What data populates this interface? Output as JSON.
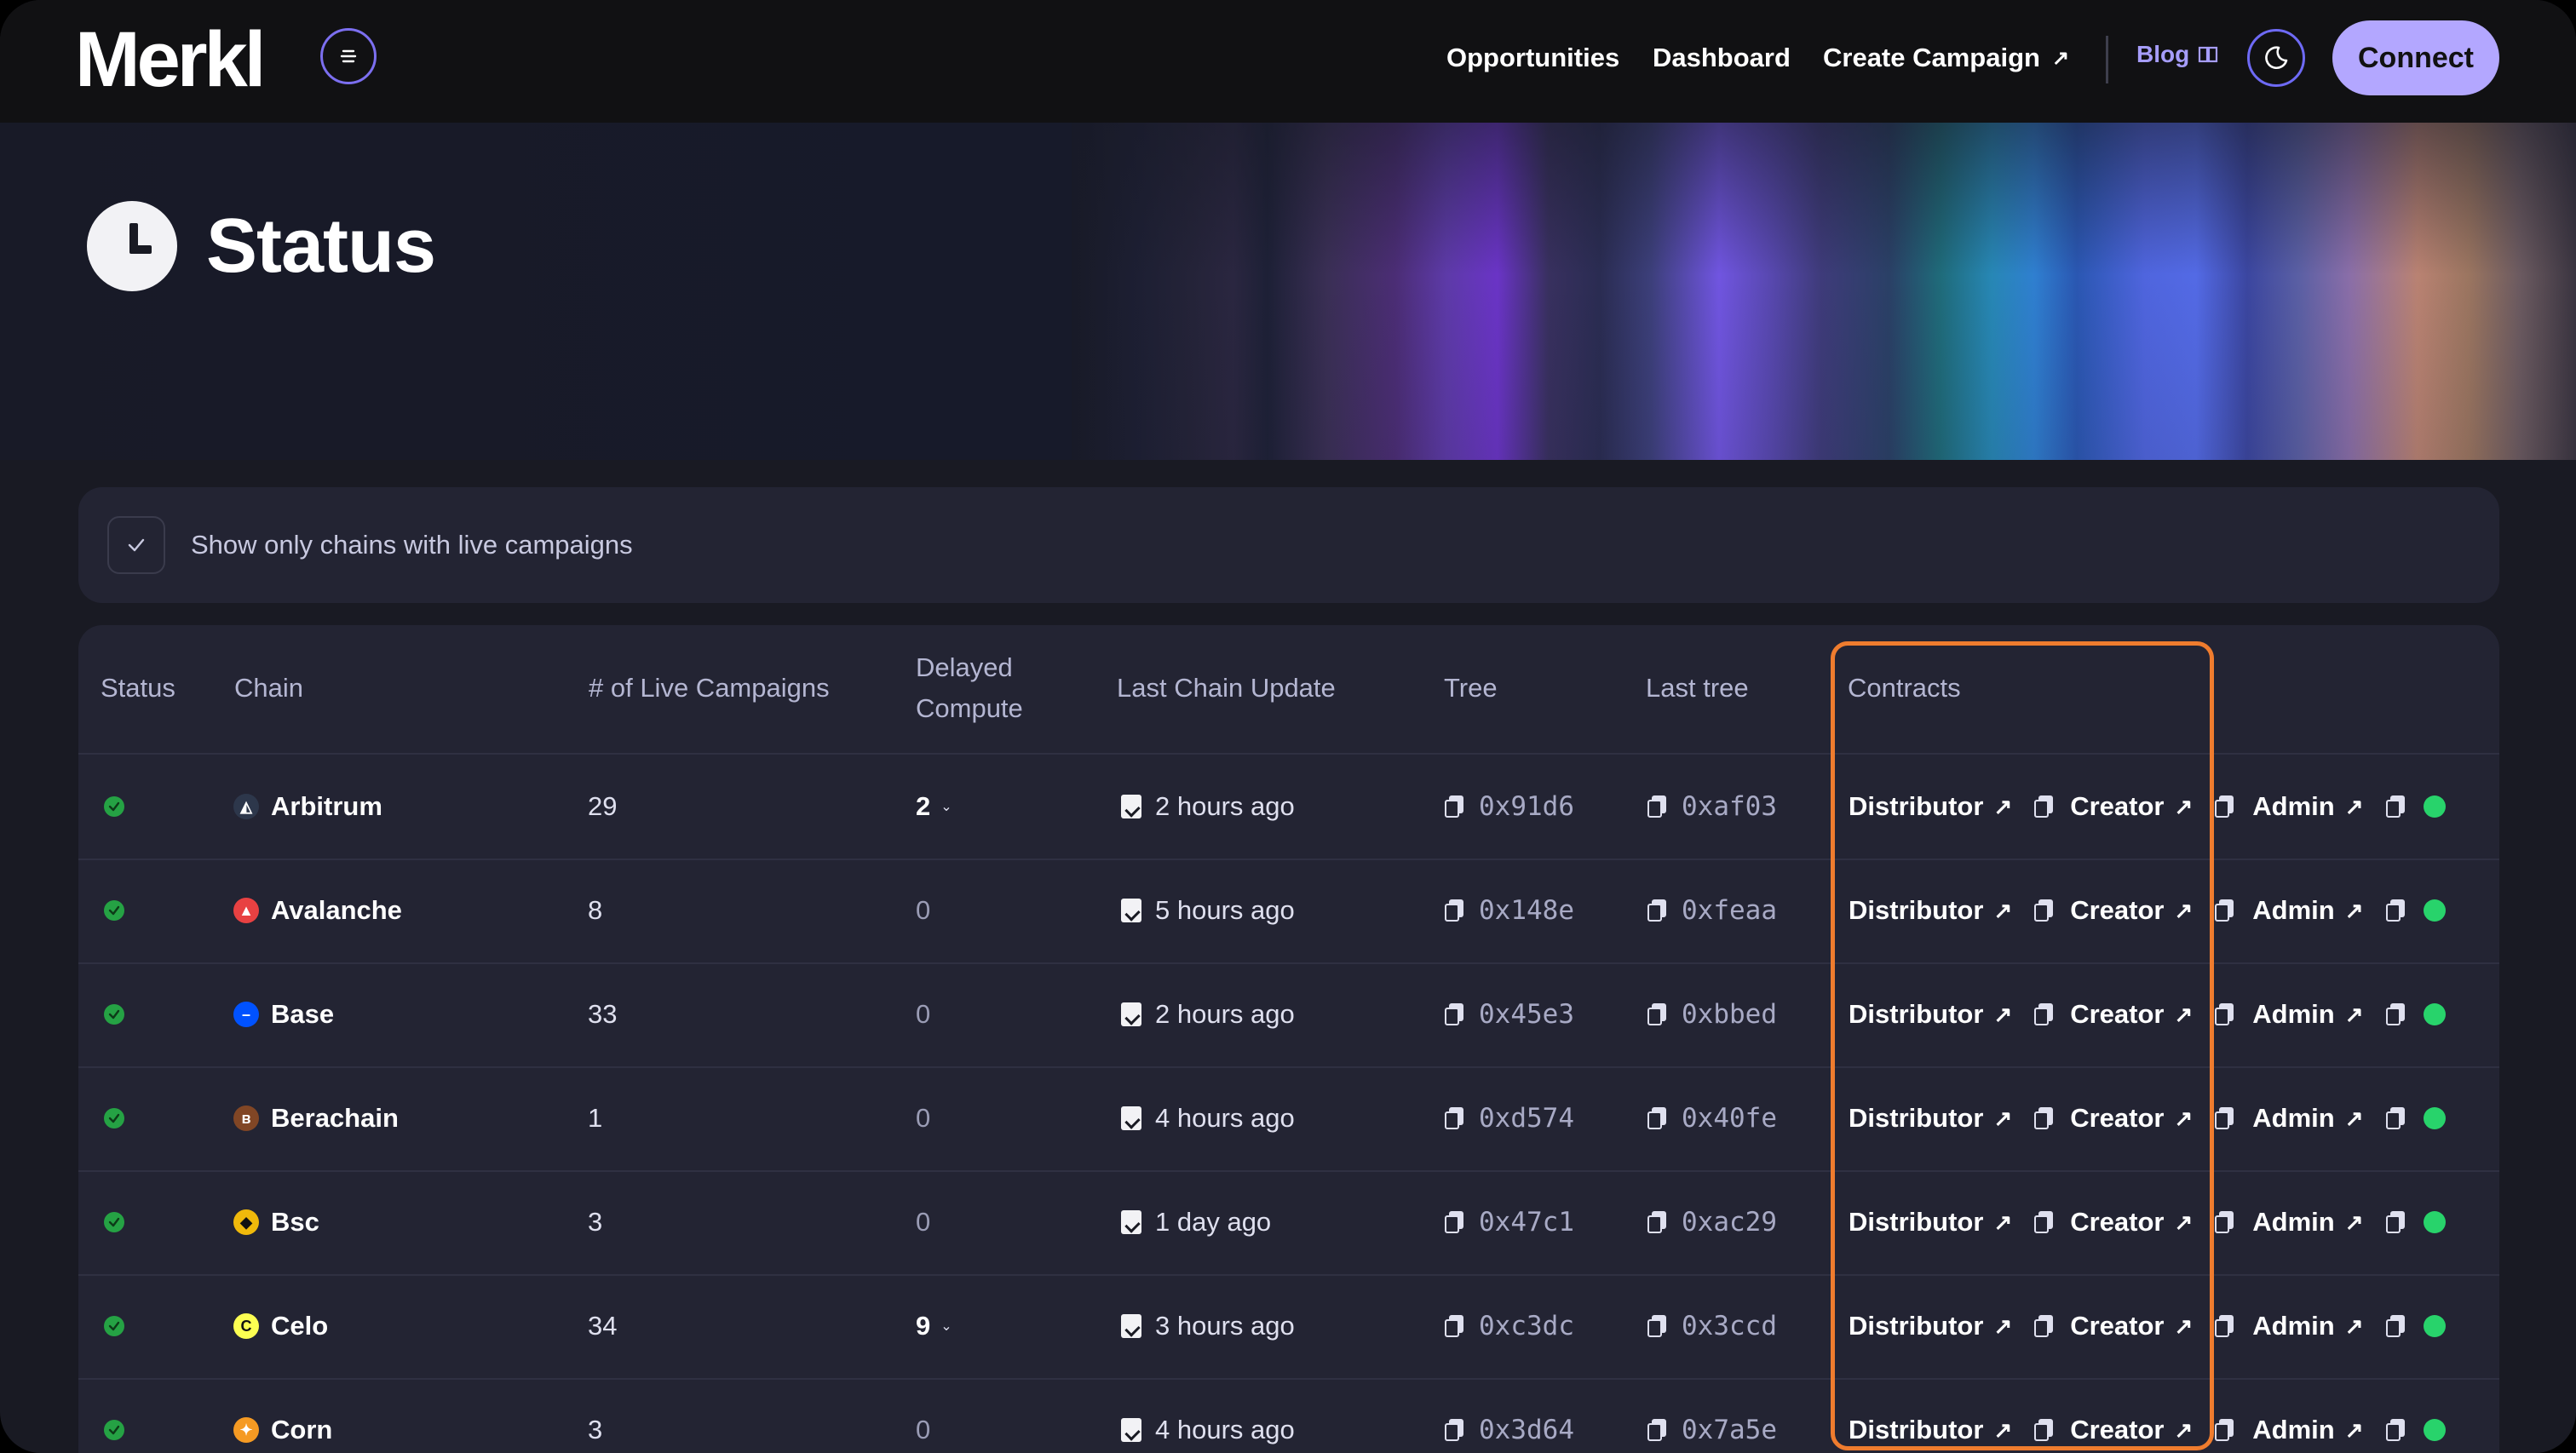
{
  "header": {
    "logo": "Merkl",
    "nav": [
      "Opportunities",
      "Dashboard",
      "Create Campaign"
    ],
    "create_campaign_arrow": "↗",
    "blog": "Blog",
    "connect": "Connect"
  },
  "hero": {
    "title": "Status"
  },
  "filter": {
    "label": "Show only chains with live campaigns",
    "checked": true
  },
  "table": {
    "headers": {
      "status": "Status",
      "chain": "Chain",
      "live_campaigns": "# of Live Campaigns",
      "delayed_line1": "Delayed",
      "delayed_line2": "Compute",
      "last_chain_update": "Last Chain Update",
      "tree": "Tree",
      "last_tree": "Last tree",
      "contracts": "Contracts"
    },
    "links": {
      "distributor": "Distributor",
      "creator": "Creator",
      "admin": "Admin"
    },
    "rows": [
      {
        "chain": "Arbitrum",
        "live": "29",
        "delayed": "2",
        "delayed_expandable": true,
        "update": "2 hours ago",
        "tree": "0x91d6",
        "last_tree": "0xaf03",
        "logo_color": "#2d374b",
        "logo_glyph": "◭"
      },
      {
        "chain": "Avalanche",
        "live": "8",
        "delayed": "0",
        "delayed_expandable": false,
        "update": "5 hours ago",
        "tree": "0x148e",
        "last_tree": "0xfeaa",
        "logo_color": "#e84142",
        "logo_glyph": "▲"
      },
      {
        "chain": "Base",
        "live": "33",
        "delayed": "0",
        "delayed_expandable": false,
        "update": "2 hours ago",
        "tree": "0x45e3",
        "last_tree": "0xbbed",
        "logo_color": "#0052ff",
        "logo_glyph": "–"
      },
      {
        "chain": "Berachain",
        "live": "1",
        "delayed": "0",
        "delayed_expandable": false,
        "update": "4 hours ago",
        "tree": "0xd574",
        "last_tree": "0x40fe",
        "logo_color": "#814625",
        "logo_glyph": "ʙ"
      },
      {
        "chain": "Bsc",
        "live": "3",
        "delayed": "0",
        "delayed_expandable": false,
        "update": "1 day ago",
        "tree": "0x47c1",
        "last_tree": "0xac29",
        "logo_color": "#f0b90b",
        "logo_glyph": "◆"
      },
      {
        "chain": "Celo",
        "live": "34",
        "delayed": "9",
        "delayed_expandable": true,
        "update": "3 hours ago",
        "tree": "0xc3dc",
        "last_tree": "0x3ccd",
        "logo_color": "#fcff52",
        "logo_glyph": "C"
      },
      {
        "chain": "Corn",
        "live": "3",
        "delayed": "0",
        "delayed_expandable": false,
        "update": "4 hours ago",
        "tree": "0x3d64",
        "last_tree": "0x7a5e",
        "logo_color": "#f59a23",
        "logo_glyph": "✦"
      }
    ]
  },
  "colors": {
    "accent": "#b3a7ff",
    "highlight": "#ef7c2e",
    "status_ok": "#25a244"
  }
}
